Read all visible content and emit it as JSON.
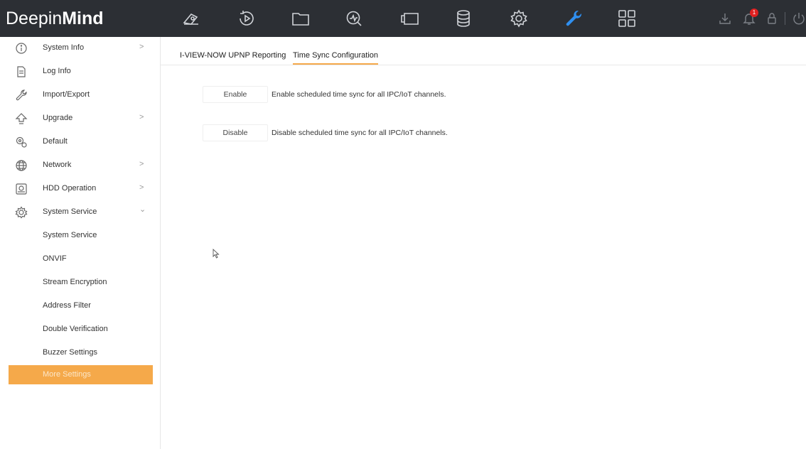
{
  "app": {
    "logo_part1": "Deepin",
    "logo_part2": "Mind"
  },
  "topnav": [
    {
      "name": "live-view-icon"
    },
    {
      "name": "playback-icon"
    },
    {
      "name": "file-icon"
    },
    {
      "name": "smart-analysis-icon"
    },
    {
      "name": "channel-icon"
    },
    {
      "name": "storage-icon"
    },
    {
      "name": "settings-gear-icon"
    },
    {
      "name": "maintenance-wrench-icon",
      "active": true
    },
    {
      "name": "grid-icon"
    }
  ],
  "toptools": {
    "alarm_count": "1"
  },
  "colors": {
    "topbar": "#2c2f34",
    "accent": "#f5a94a",
    "active_nav": "#2f8ff0"
  },
  "sidebar": {
    "items": [
      {
        "label": "System Info",
        "icon": "info-icon",
        "arrow": ">"
      },
      {
        "label": "Log Info",
        "icon": "log-icon",
        "arrow": ""
      },
      {
        "label": "Import/Export",
        "icon": "wrench-icon",
        "arrow": ""
      },
      {
        "label": "Upgrade",
        "icon": "upgrade-arrow-icon",
        "arrow": ">"
      },
      {
        "label": "Default",
        "icon": "default-gears-icon",
        "arrow": ""
      },
      {
        "label": "Network",
        "icon": "globe-icon",
        "arrow": ">"
      },
      {
        "label": "HDD Operation",
        "icon": "hdd-icon",
        "arrow": ">"
      },
      {
        "label": "System Service",
        "icon": "system-service-icon",
        "arrow": "⌄"
      }
    ],
    "subitems": [
      {
        "label": "System Service"
      },
      {
        "label": "ONVIF"
      },
      {
        "label": "Stream Encryption"
      },
      {
        "label": "Address Filter"
      },
      {
        "label": "Double Verification"
      },
      {
        "label": "Buzzer Settings"
      },
      {
        "label": "More Settings",
        "active": true
      }
    ]
  },
  "main": {
    "tabs": [
      {
        "label": "I-VIEW-NOW UPNP Reporting"
      },
      {
        "label": "Time Sync Configuration",
        "active": true
      }
    ],
    "rows": [
      {
        "button": "Enable",
        "description": "Enable scheduled time sync for all IPC/IoT channels."
      },
      {
        "button": "Disable",
        "description": "Disable scheduled time sync for all IPC/IoT channels."
      }
    ]
  }
}
